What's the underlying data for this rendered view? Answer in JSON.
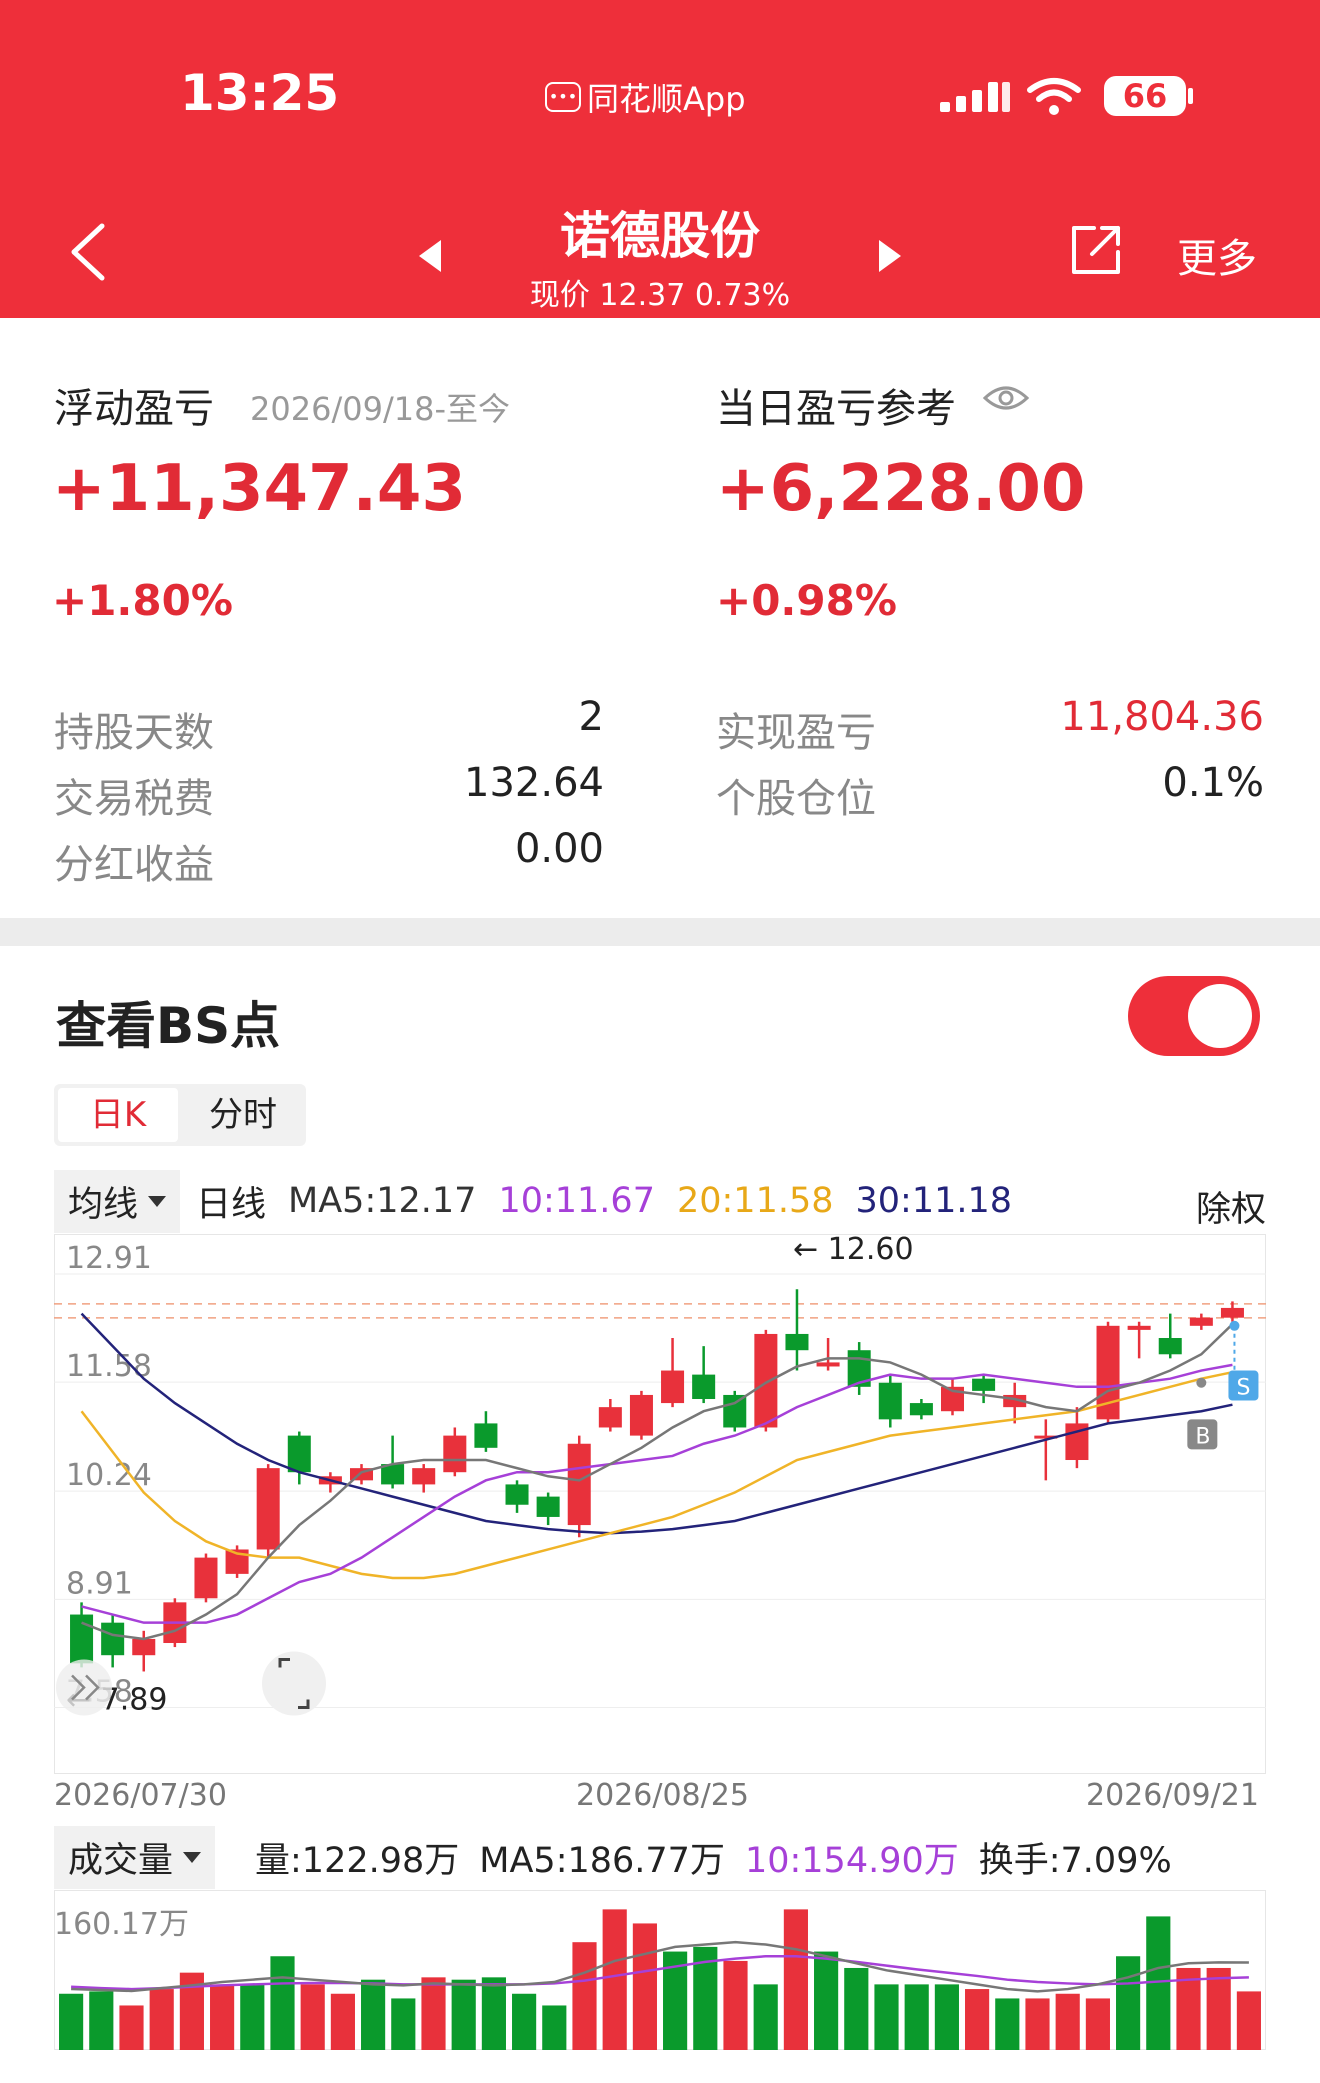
{
  "status_bar": {
    "time": "13:25",
    "app_name": "同花顺App",
    "battery": "66"
  },
  "nav": {
    "title": "诺德股份",
    "subtitle": "现价 12.37 0.73%",
    "more_label": "更多"
  },
  "floating": {
    "label": "浮动盈亏",
    "date_range": "2026/09/18-至今",
    "value": "+11,347.43",
    "pct": "+1.80%"
  },
  "daily": {
    "label": "当日盈亏参考",
    "value": "+6,228.00",
    "pct": "+0.98%"
  },
  "stats": {
    "hold_days_label": "持股天数",
    "hold_days": "2",
    "tax_label": "交易税费",
    "tax": "132.64",
    "dividend_label": "分红收益",
    "dividend": "0.00",
    "realized_label": "实现盈亏",
    "realized": "11,804.36",
    "position_label": "个股仓位",
    "position": "0.1%"
  },
  "bs": {
    "title": "查看BS点",
    "toggle_on": true,
    "tab_day": "日K",
    "tab_min": "分时"
  },
  "ma_bar": {
    "selector": "均线",
    "period": "日线",
    "ma5": "MA5:12.17",
    "ma10": "10:11.67",
    "ma20": "20:11.58",
    "ma30": "30:11.18",
    "adjust": "除权"
  },
  "colors": {
    "up": "#e8313b",
    "down": "#0a9a2c",
    "ma5": "#777777",
    "ma10": "#a640d8",
    "ma20": "#f0b428",
    "ma30": "#23237a"
  },
  "chart_data": {
    "type": "candlestick",
    "y_ticks": [
      "12.91",
      "11.58",
      "10.24",
      "8.91",
      "7.58"
    ],
    "ylim": [
      7.58,
      12.91
    ],
    "x_labels": [
      "2026/07/30",
      "2026/08/25",
      "2026/09/21"
    ],
    "high_note": "← 12.60",
    "low_note": "← 7.89",
    "markers": [
      "B",
      "S"
    ],
    "candles": [
      [
        8.6,
        8.0,
        8.75,
        7.95
      ],
      [
        8.5,
        8.1,
        8.6,
        7.95
      ],
      [
        8.1,
        8.3,
        8.4,
        7.9
      ],
      [
        8.25,
        8.75,
        8.8,
        8.2
      ],
      [
        8.8,
        9.3,
        9.35,
        8.75
      ],
      [
        9.1,
        9.4,
        9.45,
        9.05
      ],
      [
        9.4,
        10.4,
        10.45,
        9.3
      ],
      [
        10.8,
        10.35,
        10.85,
        10.2
      ],
      [
        10.2,
        10.3,
        10.35,
        10.1
      ],
      [
        10.25,
        10.4,
        10.45,
        10.2
      ],
      [
        10.45,
        10.2,
        10.8,
        10.15
      ],
      [
        10.2,
        10.4,
        10.45,
        10.1
      ],
      [
        10.35,
        10.8,
        10.9,
        10.3
      ],
      [
        10.95,
        10.65,
        11.1,
        10.6
      ],
      [
        10.2,
        9.95,
        10.25,
        9.85
      ],
      [
        10.05,
        9.8,
        10.1,
        9.7
      ],
      [
        9.7,
        10.7,
        10.8,
        9.55
      ],
      [
        10.9,
        11.15,
        11.25,
        10.85
      ],
      [
        10.8,
        11.3,
        11.35,
        10.75
      ],
      [
        11.2,
        11.6,
        12.0,
        11.15
      ],
      [
        11.55,
        11.25,
        11.9,
        11.2
      ],
      [
        11.3,
        10.9,
        11.35,
        10.85
      ],
      [
        10.9,
        12.05,
        12.1,
        10.85
      ],
      [
        12.05,
        11.85,
        12.6,
        11.6
      ],
      [
        11.65,
        11.7,
        12.0,
        11.6
      ],
      [
        11.85,
        11.4,
        11.95,
        11.3
      ],
      [
        11.45,
        11.0,
        11.55,
        10.9
      ],
      [
        11.2,
        11.05,
        11.25,
        11.0
      ],
      [
        11.1,
        11.4,
        11.5,
        11.05
      ],
      [
        11.5,
        11.35,
        11.55,
        11.2
      ],
      [
        11.15,
        11.3,
        11.45,
        10.95
      ],
      [
        10.8,
        10.8,
        11.0,
        10.25
      ],
      [
        10.5,
        10.95,
        11.15,
        10.4
      ],
      [
        11.0,
        12.15,
        12.2,
        10.95
      ],
      [
        12.1,
        12.15,
        12.2,
        11.75
      ],
      [
        12.0,
        11.8,
        12.3,
        11.75
      ],
      [
        12.15,
        12.25,
        12.3,
        12.1
      ],
      [
        12.25,
        12.37,
        12.45,
        12.2
      ]
    ],
    "ma5": [
      8.5,
      8.35,
      8.3,
      8.4,
      8.6,
      8.85,
      9.3,
      9.7,
      10.0,
      10.35,
      10.45,
      10.5,
      10.5,
      10.5,
      10.4,
      10.3,
      10.25,
      10.45,
      10.65,
      10.9,
      11.1,
      11.2,
      11.45,
      11.65,
      11.75,
      11.75,
      11.7,
      11.55,
      11.35,
      11.3,
      11.25,
      11.15,
      11.1,
      11.35,
      11.45,
      11.6,
      11.8,
      12.17
    ],
    "ma10": [
      8.7,
      8.6,
      8.5,
      8.5,
      8.5,
      8.6,
      8.8,
      9.0,
      9.1,
      9.3,
      9.55,
      9.8,
      10.05,
      10.25,
      10.35,
      10.35,
      10.4,
      10.45,
      10.5,
      10.55,
      10.7,
      10.8,
      10.95,
      11.15,
      11.3,
      11.45,
      11.55,
      11.5,
      11.5,
      11.55,
      11.5,
      11.45,
      11.4,
      11.4,
      11.45,
      11.5,
      11.6,
      11.67
    ],
    "ma20": [
      11.1,
      10.6,
      10.1,
      9.75,
      9.5,
      9.35,
      9.3,
      9.3,
      9.2,
      9.1,
      9.05,
      9.05,
      9.1,
      9.2,
      9.3,
      9.4,
      9.5,
      9.6,
      9.7,
      9.8,
      9.95,
      10.1,
      10.3,
      10.5,
      10.6,
      10.7,
      10.8,
      10.85,
      10.9,
      10.95,
      11.0,
      11.05,
      11.1,
      11.2,
      11.3,
      11.4,
      11.5,
      11.58
    ],
    "ma30": [
      12.3,
      11.9,
      11.5,
      11.2,
      10.95,
      10.7,
      10.5,
      10.35,
      10.25,
      10.15,
      10.05,
      9.95,
      9.85,
      9.75,
      9.7,
      9.65,
      9.62,
      9.6,
      9.62,
      9.65,
      9.7,
      9.75,
      9.85,
      9.95,
      10.05,
      10.15,
      10.25,
      10.35,
      10.45,
      10.55,
      10.65,
      10.75,
      10.85,
      10.95,
      11.0,
      11.05,
      11.1,
      11.18
    ]
  },
  "volume_bar": {
    "selector": "成交量",
    "vol": "量:122.98万",
    "ma5": "MA5:186.77万",
    "ma10": "10:154.90万",
    "turnover": "换手:7.09%",
    "y_tick": "160.17万"
  },
  "volume_data": {
    "values": [
      120,
      125,
      95,
      130,
      165,
      140,
      140,
      200,
      140,
      120,
      150,
      110,
      155,
      150,
      155,
      120,
      95,
      230,
      300,
      270,
      210,
      220,
      190,
      140,
      300,
      210,
      175,
      140,
      140,
      140,
      130,
      110,
      110,
      120,
      110,
      200,
      285,
      175,
      175,
      125
    ],
    "ma5": [
      130,
      128,
      126,
      132,
      138,
      145,
      150,
      155,
      150,
      145,
      140,
      138,
      142,
      140,
      138,
      140,
      145,
      165,
      190,
      205,
      220,
      225,
      230,
      225,
      215,
      200,
      185,
      170,
      160,
      150,
      140,
      130,
      125,
      130,
      140,
      155,
      175,
      185,
      187,
      186.77
    ],
    "ma10": [
      135,
      132,
      130,
      132,
      135,
      138,
      140,
      142,
      143,
      143,
      142,
      140,
      140,
      140,
      140,
      140,
      142,
      148,
      158,
      168,
      178,
      188,
      195,
      200,
      200,
      195,
      188,
      180,
      172,
      165,
      158,
      150,
      145,
      142,
      140,
      142,
      146,
      150,
      153,
      154.9
    ]
  }
}
